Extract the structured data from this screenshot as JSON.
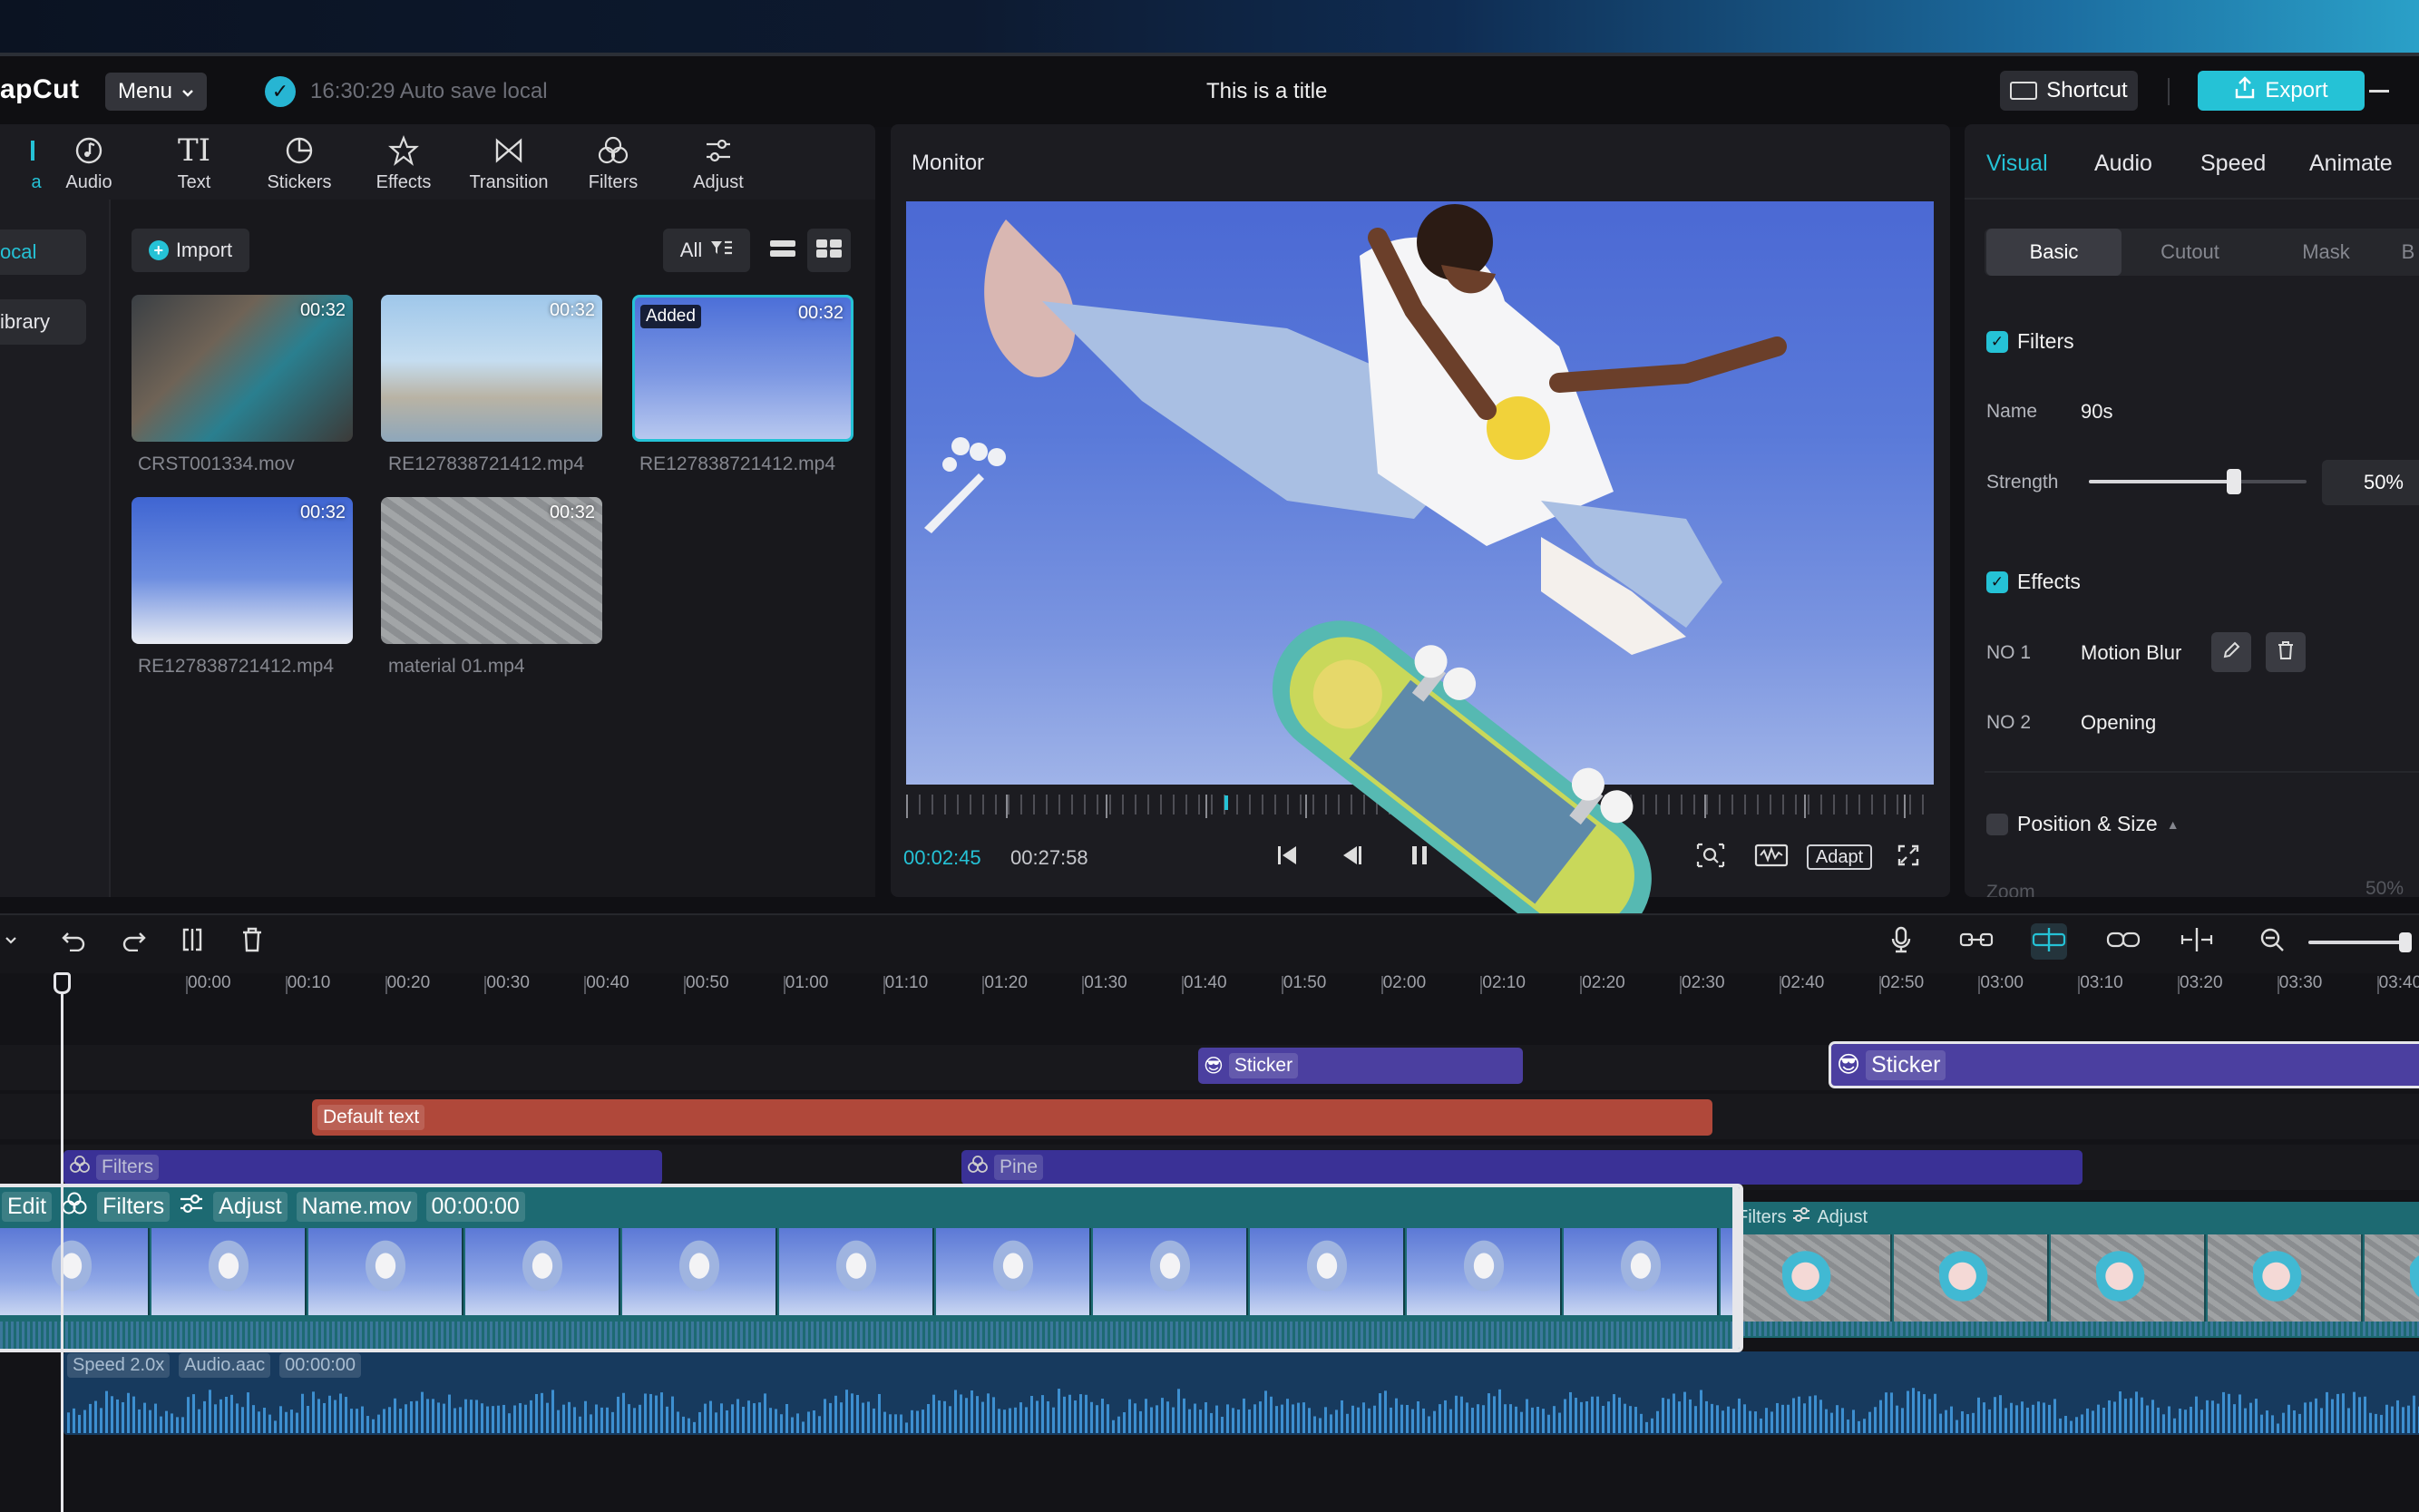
{
  "app": {
    "logo": "apCut",
    "menu_label": "Menu",
    "save_status": "16:30:29 Auto save local",
    "title": "This is a title",
    "shortcut_label": "Shortcut",
    "export_label": "Export"
  },
  "toolbar": {
    "items": [
      {
        "label": "a",
        "icon": "media-icon"
      },
      {
        "label": "Audio",
        "icon": "audio-icon"
      },
      {
        "label": "Text",
        "icon": "text-icon"
      },
      {
        "label": "Stickers",
        "icon": "stickers-icon"
      },
      {
        "label": "Effects",
        "icon": "effects-icon"
      },
      {
        "label": "Transition",
        "icon": "transition-icon"
      },
      {
        "label": "Filters",
        "icon": "filters-icon"
      },
      {
        "label": "Adjust",
        "icon": "adjust-icon"
      }
    ]
  },
  "media": {
    "sidebar": [
      {
        "label": "ocal",
        "active": true
      },
      {
        "label": "ibrary",
        "active": false
      }
    ],
    "import_label": "Import",
    "filter_label": "All",
    "items": [
      {
        "name": "CRST001334.mov",
        "duration": "00:32",
        "added": ""
      },
      {
        "name": "RE127838721412.mp4",
        "duration": "00:32",
        "added": ""
      },
      {
        "name": "RE127838721412.mp4",
        "duration": "00:32",
        "added": "Added"
      },
      {
        "name": "RE127838721412.mp4",
        "duration": "00:32",
        "added": ""
      },
      {
        "name": "material 01.mp4",
        "duration": "00:32",
        "added": ""
      }
    ]
  },
  "monitor": {
    "title": "Monitor",
    "current_time": "00:02:45",
    "total_time": "00:27:58",
    "adapt_label": "Adapt"
  },
  "inspector": {
    "tabs": [
      {
        "label": "Visual",
        "active": true
      },
      {
        "label": "Audio"
      },
      {
        "label": "Speed"
      },
      {
        "label": "Animate"
      }
    ],
    "subtabs": [
      {
        "label": "Basic",
        "active": true
      },
      {
        "label": "Cutout"
      },
      {
        "label": "Mask"
      },
      {
        "label": "B"
      }
    ],
    "filters": {
      "title": "Filters",
      "name_label": "Name",
      "name_value": "90s",
      "strength_label": "Strength",
      "strength_value": "50%",
      "strength_fraction": 0.5
    },
    "effects": {
      "title": "Effects",
      "rows": [
        {
          "label": "NO 1",
          "value": "Motion Blur"
        },
        {
          "label": "NO 2",
          "value": "Opening"
        }
      ]
    },
    "position": {
      "title": "Position & Size",
      "zoom_label": "Zoom",
      "zoom_value": "50%"
    }
  },
  "timeline": {
    "ticks": [
      "00:00",
      "00:10",
      "00:20",
      "00:30",
      "00:40",
      "00:50",
      "01:00",
      "01:10",
      "01:20",
      "01:30",
      "01:40",
      "01:50",
      "02:00",
      "02:10",
      "02:20",
      "02:30",
      "02:40",
      "02:50",
      "03:00",
      "03:10",
      "03:20",
      "03:30",
      "03:40"
    ],
    "sticker_1": "Sticker",
    "sticker_2": "Sticker",
    "text_clip": "Default text",
    "filter_clip_1": "Filters",
    "filter_clip_2": "Pine",
    "main_clip": {
      "edit": "Edit",
      "filters": "Filters",
      "adjust": "Adjust",
      "name": "Name.mov",
      "time": "00:00:00"
    },
    "second_clip": {
      "filters": "Filters",
      "adjust": "Adjust"
    },
    "audio_clip": {
      "speed": "Speed 2.0x",
      "name": "Audio.aac",
      "time": "00:00:00"
    }
  },
  "colors": {
    "accent": "#25c2d6",
    "sticker": "#4b3fa0",
    "text_clip": "#b0483a",
    "filter_clip": "#3a3196",
    "main_clip": "#1d6a72"
  }
}
